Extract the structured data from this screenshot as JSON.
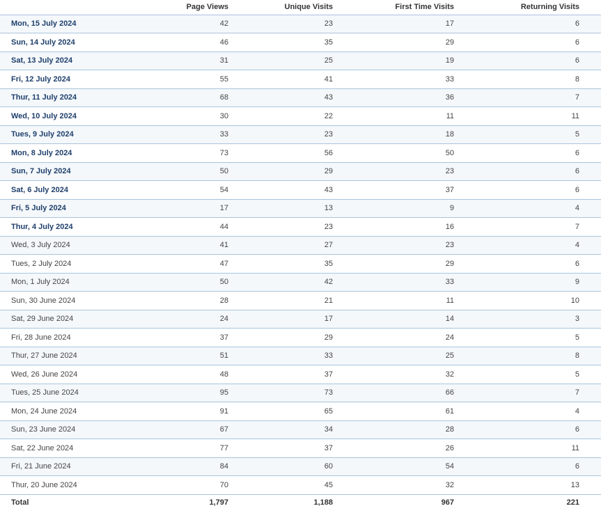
{
  "headers": {
    "date": "",
    "page_views": "Page Views",
    "unique_visits": "Unique Visits",
    "first_time_visits": "First Time Visits",
    "returning_visits": "Returning Visits"
  },
  "rows": [
    {
      "date": "Mon, 15 July 2024",
      "link": true,
      "pv": "42",
      "uv": "23",
      "ft": "17",
      "rv": "6"
    },
    {
      "date": "Sun, 14 July 2024",
      "link": true,
      "pv": "46",
      "uv": "35",
      "ft": "29",
      "rv": "6"
    },
    {
      "date": "Sat, 13 July 2024",
      "link": true,
      "pv": "31",
      "uv": "25",
      "ft": "19",
      "rv": "6"
    },
    {
      "date": "Fri, 12 July 2024",
      "link": true,
      "pv": "55",
      "uv": "41",
      "ft": "33",
      "rv": "8"
    },
    {
      "date": "Thur, 11 July 2024",
      "link": true,
      "pv": "68",
      "uv": "43",
      "ft": "36",
      "rv": "7"
    },
    {
      "date": "Wed, 10 July 2024",
      "link": true,
      "pv": "30",
      "uv": "22",
      "ft": "11",
      "rv": "11"
    },
    {
      "date": "Tues, 9 July 2024",
      "link": true,
      "pv": "33",
      "uv": "23",
      "ft": "18",
      "rv": "5"
    },
    {
      "date": "Mon, 8 July 2024",
      "link": true,
      "pv": "73",
      "uv": "56",
      "ft": "50",
      "rv": "6"
    },
    {
      "date": "Sun, 7 July 2024",
      "link": true,
      "pv": "50",
      "uv": "29",
      "ft": "23",
      "rv": "6"
    },
    {
      "date": "Sat, 6 July 2024",
      "link": true,
      "pv": "54",
      "uv": "43",
      "ft": "37",
      "rv": "6"
    },
    {
      "date": "Fri, 5 July 2024",
      "link": true,
      "pv": "17",
      "uv": "13",
      "ft": "9",
      "rv": "4"
    },
    {
      "date": "Thur, 4 July 2024",
      "link": true,
      "pv": "44",
      "uv": "23",
      "ft": "16",
      "rv": "7"
    },
    {
      "date": "Wed, 3 July 2024",
      "link": false,
      "pv": "41",
      "uv": "27",
      "ft": "23",
      "rv": "4"
    },
    {
      "date": "Tues, 2 July 2024",
      "link": false,
      "pv": "47",
      "uv": "35",
      "ft": "29",
      "rv": "6"
    },
    {
      "date": "Mon, 1 July 2024",
      "link": false,
      "pv": "50",
      "uv": "42",
      "ft": "33",
      "rv": "9"
    },
    {
      "date": "Sun, 30 June 2024",
      "link": false,
      "pv": "28",
      "uv": "21",
      "ft": "11",
      "rv": "10"
    },
    {
      "date": "Sat, 29 June 2024",
      "link": false,
      "pv": "24",
      "uv": "17",
      "ft": "14",
      "rv": "3"
    },
    {
      "date": "Fri, 28 June 2024",
      "link": false,
      "pv": "37",
      "uv": "29",
      "ft": "24",
      "rv": "5"
    },
    {
      "date": "Thur, 27 June 2024",
      "link": false,
      "pv": "51",
      "uv": "33",
      "ft": "25",
      "rv": "8"
    },
    {
      "date": "Wed, 26 June 2024",
      "link": false,
      "pv": "48",
      "uv": "37",
      "ft": "32",
      "rv": "5"
    },
    {
      "date": "Tues, 25 June 2024",
      "link": false,
      "pv": "95",
      "uv": "73",
      "ft": "66",
      "rv": "7"
    },
    {
      "date": "Mon, 24 June 2024",
      "link": false,
      "pv": "91",
      "uv": "65",
      "ft": "61",
      "rv": "4"
    },
    {
      "date": "Sun, 23 June 2024",
      "link": false,
      "pv": "67",
      "uv": "34",
      "ft": "28",
      "rv": "6"
    },
    {
      "date": "Sat, 22 June 2024",
      "link": false,
      "pv": "77",
      "uv": "37",
      "ft": "26",
      "rv": "11"
    },
    {
      "date": "Fri, 21 June 2024",
      "link": false,
      "pv": "84",
      "uv": "60",
      "ft": "54",
      "rv": "6"
    },
    {
      "date": "Thur, 20 June 2024",
      "link": false,
      "pv": "70",
      "uv": "45",
      "ft": "32",
      "rv": "13"
    }
  ],
  "total": {
    "label": "Total",
    "pv": "1,797",
    "uv": "1,188",
    "ft": "967",
    "rv": "221"
  },
  "colors": {
    "link_text": "#1f3f6b",
    "row_border": "#a9c4dc",
    "odd_row_bg": "#f4f8fb"
  }
}
